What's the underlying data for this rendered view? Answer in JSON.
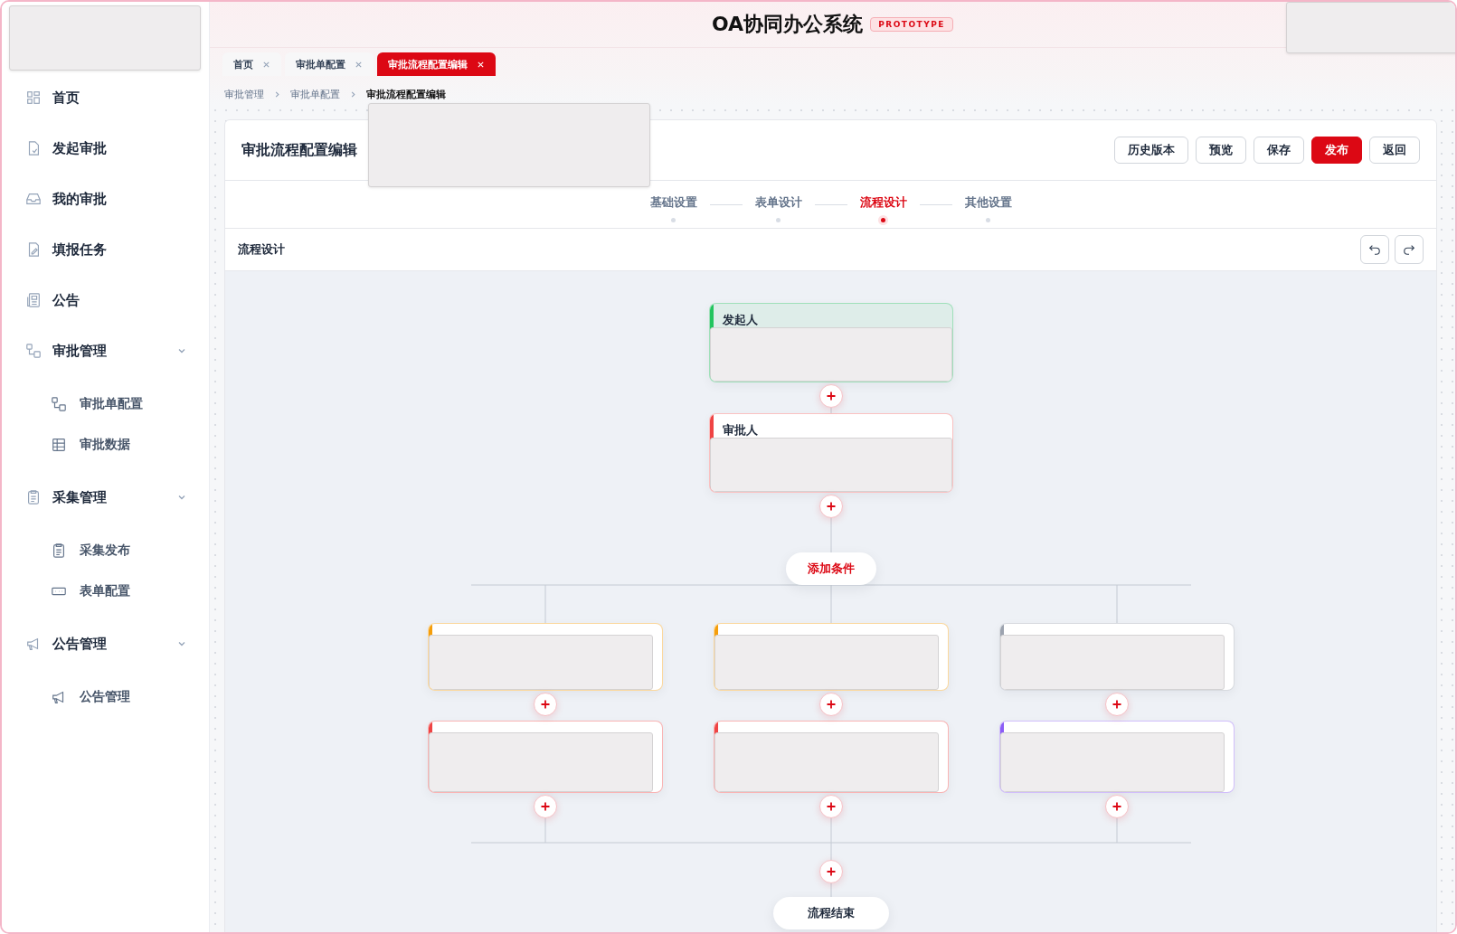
{
  "header": {
    "title": "OA协同办公系统",
    "badge": "PROTOTYPE"
  },
  "sidebar": {
    "items": [
      {
        "label": "首页",
        "selected": false
      },
      {
        "label": "发起审批",
        "selected": false
      },
      {
        "label": "我的审批",
        "selected": false
      },
      {
        "label": "填报任务",
        "selected": false
      },
      {
        "label": "公告",
        "selected": false
      },
      {
        "label": "审批管理",
        "expanded": true,
        "children": [
          {
            "label": "审批单配置",
            "selected": false
          },
          {
            "label": "审批数据",
            "selected": false
          }
        ]
      },
      {
        "label": "采集管理",
        "expanded": true,
        "children": [
          {
            "label": "采集发布",
            "selected": false
          },
          {
            "label": "表单配置",
            "selected": false
          }
        ]
      },
      {
        "label": "公告管理",
        "expanded": true,
        "children": [
          {
            "label": "公告管理",
            "selected": false
          }
        ]
      }
    ]
  },
  "tabs": [
    {
      "label": "首页",
      "selected": false
    },
    {
      "label": "审批单配置",
      "selected": false
    },
    {
      "label": "审批流程配置编辑",
      "selected": true
    }
  ],
  "breadcrumb": [
    "审批管理",
    "审批单配置",
    "审批流程配置编辑"
  ],
  "page": {
    "title": "审批流程配置编辑",
    "buttons": [
      {
        "label": "历史版本",
        "kind": "default"
      },
      {
        "label": "预览",
        "kind": "default"
      },
      {
        "label": "保存",
        "kind": "default"
      },
      {
        "label": "发布",
        "kind": "primary"
      },
      {
        "label": "返回",
        "kind": "default"
      }
    ],
    "steps": [
      {
        "label": "基础设置",
        "selected": false
      },
      {
        "label": "表单设计",
        "selected": false
      },
      {
        "label": "流程设计",
        "selected": true
      },
      {
        "label": "其他设置",
        "selected": false
      }
    ],
    "section_title": "流程设计"
  },
  "flow": {
    "nodes": [
      {
        "title": "发起人",
        "color": "#22c55e"
      },
      {
        "title": "审批人",
        "color": "#ef4444"
      }
    ],
    "add_condition": "添加条件",
    "branches": [
      {
        "nodes": [
          {
            "color": "#f59e0b"
          },
          {
            "color": "#ef4444"
          }
        ]
      },
      {
        "nodes": [
          {
            "color": "#f59e0b"
          },
          {
            "color": "#ef4444"
          }
        ]
      },
      {
        "nodes": [
          {
            "color": "#9ca3af"
          },
          {
            "color": "#8b5cf6"
          }
        ]
      }
    ],
    "end": "流程结束"
  }
}
